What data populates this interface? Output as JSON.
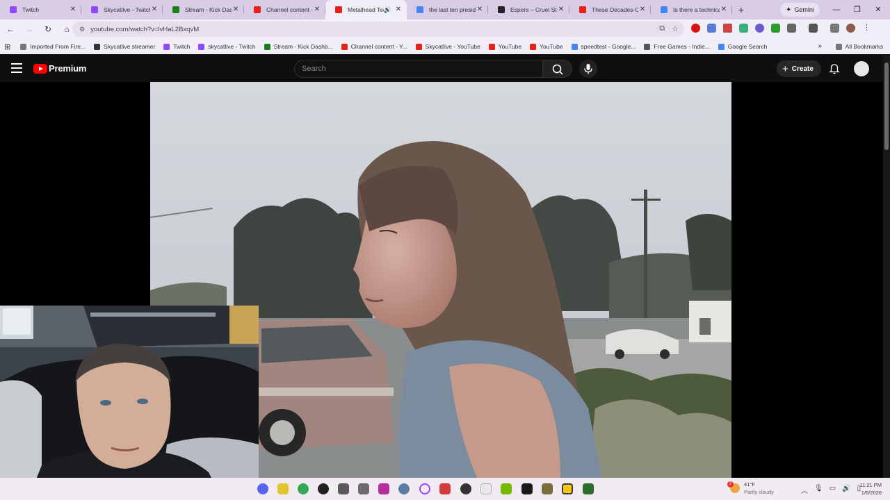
{
  "browser": {
    "tabs": [
      {
        "title": "Twitch",
        "favicon": "twitch-icon",
        "color": "#9146ff",
        "active": false
      },
      {
        "title": "Skycatlive - Twitch",
        "favicon": "twitch-icon",
        "color": "#9146ff",
        "active": false
      },
      {
        "title": "Stream - Kick Dashb",
        "favicon": "kick-icon",
        "color": "#1a7f1a",
        "active": false
      },
      {
        "title": "Channel content - Y",
        "favicon": "youtube-studio-icon",
        "color": "#e62117",
        "active": false
      },
      {
        "title": "Metalhead Teen",
        "favicon": "youtube-icon",
        "color": "#e62117",
        "active": true
      },
      {
        "title": "the last ten presid",
        "favicon": "google-icon",
        "color": "#4285f4",
        "active": false
      },
      {
        "title": "Espers – Cruel Stor",
        "favicon": "cruel-stories-icon",
        "color": "#222222",
        "active": false
      },
      {
        "title": "These Decades-Old",
        "favicon": "youtube-icon",
        "color": "#e62117",
        "active": false
      },
      {
        "title": "Is there a technical",
        "favicon": "google-icon",
        "color": "#4285f4",
        "active": false
      }
    ],
    "new_tab": "+",
    "gemini_label": "Gemini",
    "url": "youtube.com/watch?v=lvHaL2BxqvM",
    "bookmarks": [
      {
        "label": "Imported From Fire...",
        "icon": "folder-icon",
        "color": "#777777"
      },
      {
        "label": "Skycatlive streamer",
        "icon": "skycat-icon",
        "color": "#333333"
      },
      {
        "label": "Twitch",
        "icon": "twitch-icon",
        "color": "#9146ff"
      },
      {
        "label": "skycatlive - Twitch",
        "icon": "twitch-icon",
        "color": "#9146ff"
      },
      {
        "label": "Stream - Kick Dashb...",
        "icon": "kick-icon",
        "color": "#1a7f1a"
      },
      {
        "label": "Channel content - Y...",
        "icon": "youtube-icon",
        "color": "#e62117"
      },
      {
        "label": "Skycatlive - YouTube",
        "icon": "youtube-icon",
        "color": "#e62117"
      },
      {
        "label": "YouTube",
        "icon": "youtube-icon",
        "color": "#e62117"
      },
      {
        "label": "YouTube",
        "icon": "youtube-icon",
        "color": "#e62117"
      },
      {
        "label": "speedtest - Google...",
        "icon": "google-icon",
        "color": "#4285f4"
      },
      {
        "label": "Free Games - Indie...",
        "icon": "itch-icon",
        "color": "#555555"
      },
      {
        "label": "Google Search",
        "icon": "google-icon",
        "color": "#4285f4"
      }
    ],
    "all_bookmarks": "All Bookmarks"
  },
  "youtube": {
    "logo_text": "Premium",
    "search_placeholder": "Search",
    "create_label": "Create",
    "brand_color": "#ff0000"
  },
  "taskbar": {
    "weather": {
      "temp": "41°F",
      "condition": "Partly cloudy",
      "badge": "2"
    },
    "time": "11:21 PM",
    "date": "1/6/2026"
  }
}
